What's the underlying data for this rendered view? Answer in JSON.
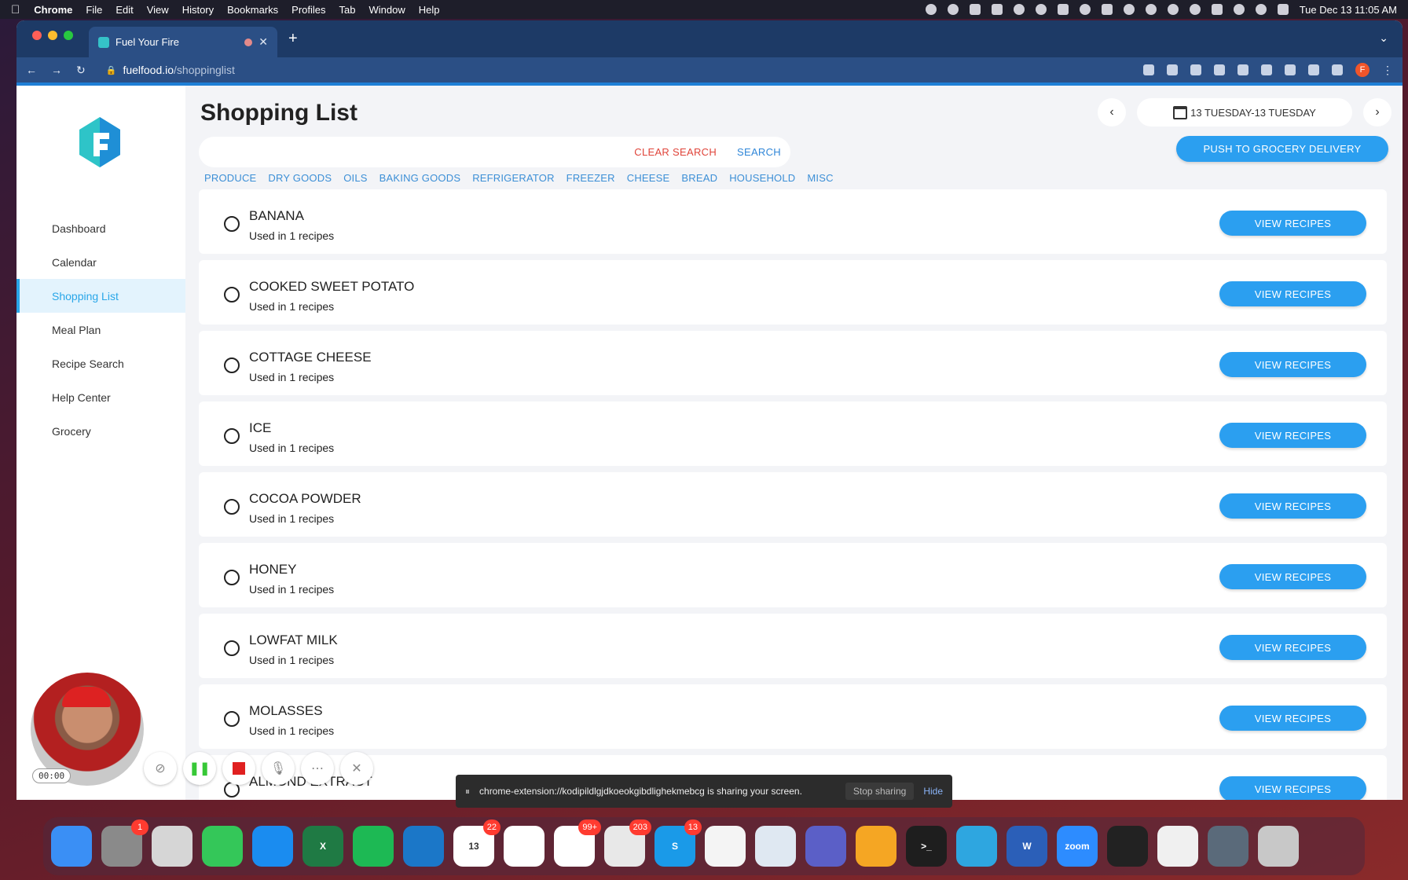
{
  "menubar": {
    "app": "Chrome",
    "items": [
      "File",
      "Edit",
      "View",
      "History",
      "Bookmarks",
      "Profiles",
      "Tab",
      "Window",
      "Help"
    ],
    "clock": "Tue Dec 13  11:05 AM"
  },
  "browser": {
    "tab_title": "Fuel Your Fire",
    "new_tab": "+",
    "url_host": "fuelfood.io",
    "url_path": "/shoppinglist",
    "profile_initial": "F"
  },
  "sidebar": {
    "items": [
      {
        "label": "Dashboard"
      },
      {
        "label": "Calendar"
      },
      {
        "label": "Shopping List",
        "active": true
      },
      {
        "label": "Meal Plan"
      },
      {
        "label": "Recipe Search"
      },
      {
        "label": "Help Center"
      },
      {
        "label": "Grocery"
      }
    ]
  },
  "main": {
    "title": "Shopping List",
    "search": {
      "placeholder": "",
      "clear_label": "CLEAR SEARCH",
      "search_label": "SEARCH"
    },
    "categories": [
      "PRODUCE",
      "DRY GOODS",
      "OILS",
      "BAKING GOODS",
      "REFRIGERATOR",
      "FREEZER",
      "CHEESE",
      "BREAD",
      "HOUSEHOLD",
      "MISC"
    ],
    "date_range": "13 TUESDAY-13 TUESDAY",
    "push_label": "PUSH TO GROCERY DELIVERY",
    "view_label": "VIEW RECIPES",
    "items": [
      {
        "name": "BANANA",
        "sub": "Used in 1 recipes"
      },
      {
        "name": "COOKED SWEET POTATO",
        "sub": "Used in 1 recipes"
      },
      {
        "name": "COTTAGE CHEESE",
        "sub": "Used in 1 recipes"
      },
      {
        "name": "ICE",
        "sub": "Used in 1 recipes"
      },
      {
        "name": "COCOA POWDER",
        "sub": "Used in 1 recipes"
      },
      {
        "name": "HONEY",
        "sub": "Used in 1 recipes"
      },
      {
        "name": "LOWFAT MILK",
        "sub": "Used in 1 recipes"
      },
      {
        "name": "MOLASSES",
        "sub": "Used in 1 recipes"
      },
      {
        "name": "ALMOND EXTRACT",
        "sub": ""
      }
    ]
  },
  "recorder": {
    "timer": "00:00"
  },
  "share_bar": {
    "message": "chrome-extension://kodipildlgjdkoeokgibdlighekmebcg is sharing your screen.",
    "stop_label": "Stop sharing",
    "hide_label": "Hide"
  },
  "dock": {
    "icons": [
      {
        "name": "finder",
        "color": "#3a8ff5",
        "label": ""
      },
      {
        "name": "system-settings",
        "color": "#8a8a8a",
        "label": "",
        "badge": "1"
      },
      {
        "name": "launchpad",
        "color": "#d6d6d6",
        "label": ""
      },
      {
        "name": "messages",
        "color": "#34c759",
        "label": ""
      },
      {
        "name": "app-store",
        "color": "#1a8cf0",
        "label": ""
      },
      {
        "name": "excel",
        "color": "#1f7a44",
        "label": "X"
      },
      {
        "name": "spotify",
        "color": "#1db954",
        "label": ""
      },
      {
        "name": "vscode",
        "color": "#1b77c8",
        "label": ""
      },
      {
        "name": "calendar",
        "color": "#ffffff",
        "label": "13",
        "badge": "22"
      },
      {
        "name": "slack",
        "color": "#ffffff",
        "label": ""
      },
      {
        "name": "clickup",
        "color": "#ffffff",
        "label": "",
        "badge": "99+"
      },
      {
        "name": "mail",
        "color": "#e8e8e8",
        "label": "",
        "badge": "203"
      },
      {
        "name": "skype",
        "color": "#1a9ae8",
        "label": "S",
        "badge": "13"
      },
      {
        "name": "textedit",
        "color": "#f4f4f4",
        "label": ""
      },
      {
        "name": "preview",
        "color": "#dfe8f2",
        "label": ""
      },
      {
        "name": "teams",
        "color": "#5b5fc7",
        "label": ""
      },
      {
        "name": "mamp",
        "color": "#f5a623",
        "label": ""
      },
      {
        "name": "terminal",
        "color": "#1e1e1e",
        "label": ">_"
      },
      {
        "name": "telegram",
        "color": "#2ea6e0",
        "label": ""
      },
      {
        "name": "word",
        "color": "#2b5fb8",
        "label": "W"
      },
      {
        "name": "zoom",
        "color": "#2d8cff",
        "label": "zoom"
      },
      {
        "name": "activity-monitor",
        "color": "#222222",
        "label": ""
      },
      {
        "name": "chrome",
        "color": "#f0f0f0",
        "label": ""
      },
      {
        "name": "quicktime",
        "color": "#5a6a7a",
        "label": ""
      },
      {
        "name": "trash",
        "color": "#c8c8c8",
        "label": ""
      }
    ]
  }
}
